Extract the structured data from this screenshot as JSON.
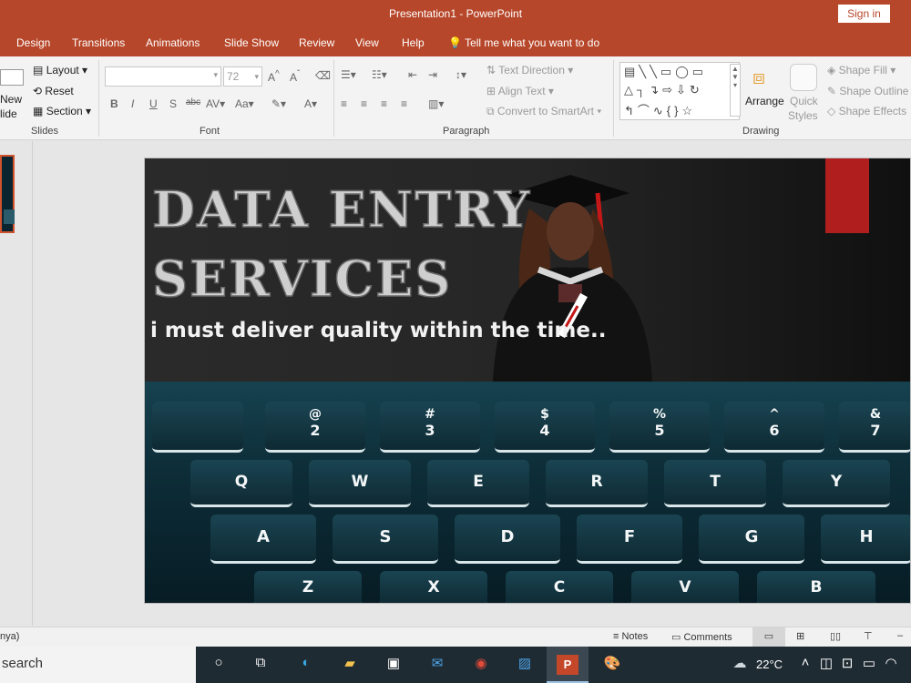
{
  "window": {
    "title": "Presentation1  -  PowerPoint",
    "signin": "Sign in"
  },
  "tabs": [
    "Design",
    "Transitions",
    "Animations",
    "Slide Show",
    "Review",
    "View",
    "Help"
  ],
  "tellme": "Tell me what you want to do",
  "ribbon": {
    "slides": {
      "new_line1": "New",
      "new_line2": "lide",
      "layout": "Layout",
      "reset": "Reset",
      "section": "Section",
      "label": "Slides"
    },
    "font": {
      "size": "72",
      "label": "Font"
    },
    "paragraph": {
      "text_direction": "Text Direction",
      "align_text": "Align Text",
      "convert_smartart": "Convert to SmartArt",
      "label": "Paragraph"
    },
    "drawing": {
      "arrange": "Arrange",
      "quick_styles_1": "Quick",
      "quick_styles_2": "Styles",
      "shape_fill": "Shape Fill",
      "shape_outline": "Shape Outline",
      "shape_effects": "Shape Effects",
      "label": "Drawing"
    }
  },
  "slide": {
    "title_line1": "DATA ENTRY",
    "title_line2": "SERVICES",
    "tagline": "i must deliver quality within the time..",
    "keys_row1": [
      "",
      "2",
      "3",
      "4",
      "5",
      "6",
      "7"
    ],
    "keys_row1_top": [
      "",
      "@",
      "#",
      "$",
      "%",
      "^",
      "&"
    ],
    "keys_row2": [
      "Q",
      "W",
      "E",
      "R",
      "T",
      "Y"
    ],
    "keys_row3": [
      "A",
      "S",
      "D",
      "F",
      "G",
      "H"
    ],
    "keys_row4": [
      "Z",
      "X",
      "C",
      "V",
      "B"
    ]
  },
  "status": {
    "language": "nya)",
    "notes": "Notes",
    "comments": "Comments"
  },
  "taskbar": {
    "search": "search",
    "temperature": "22°C"
  },
  "colors": {
    "accent": "#b7472a",
    "slide_red": "#b01e1e",
    "taskbar": "#1f2b33"
  }
}
